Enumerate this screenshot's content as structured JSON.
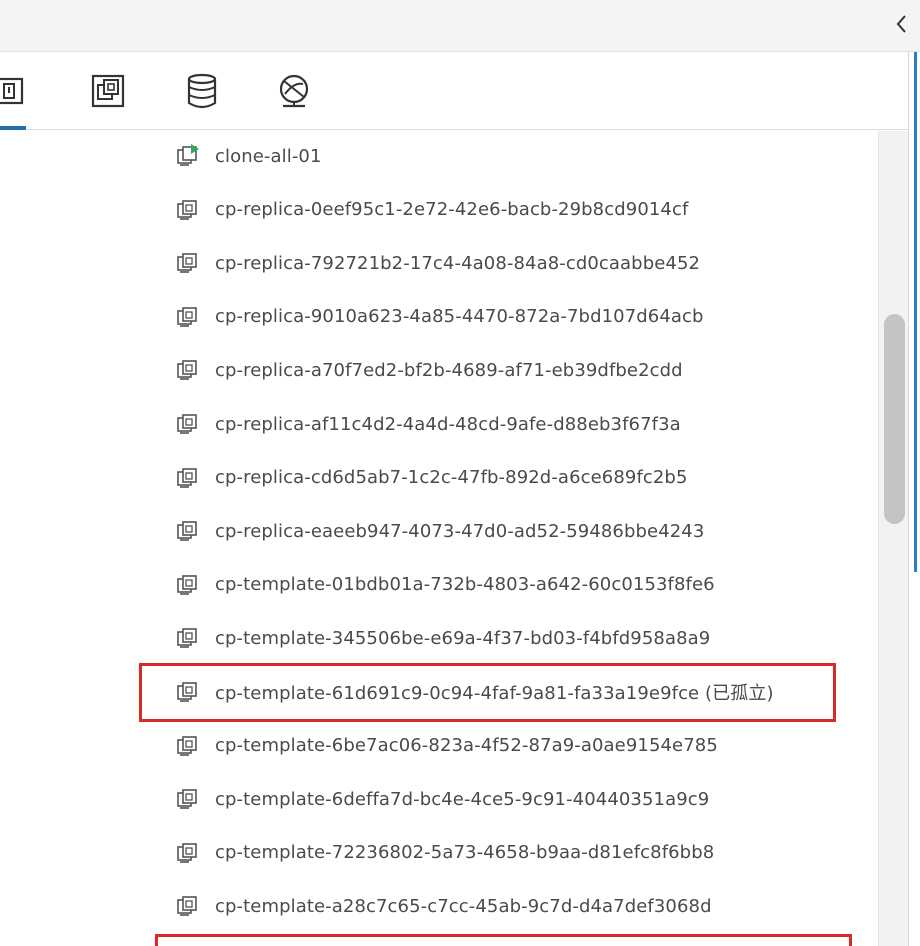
{
  "tabs": [
    {
      "name": "hosts-and-clusters",
      "icon": "hosts-clusters-icon",
      "active": true
    },
    {
      "name": "vms-and-templates",
      "icon": "vms-templates-icon",
      "active": false
    },
    {
      "name": "storage",
      "icon": "storage-icon",
      "active": false
    },
    {
      "name": "networking",
      "icon": "networking-icon",
      "active": false
    }
  ],
  "collapse_icon": "chevron-left-icon",
  "items": [
    {
      "label": "clone-all-01",
      "icon": "vm-powered-on-icon"
    },
    {
      "label": "cp-replica-0eef95c1-2e72-42e6-bacb-29b8cd9014cf",
      "icon": "vm-icon"
    },
    {
      "label": "cp-replica-792721b2-17c4-4a08-84a8-cd0caabbe452",
      "icon": "vm-icon"
    },
    {
      "label": "cp-replica-9010a623-4a85-4470-872a-7bd107d64acb",
      "icon": "vm-icon"
    },
    {
      "label": "cp-replica-a70f7ed2-bf2b-4689-af71-eb39dfbe2cdd",
      "icon": "vm-icon"
    },
    {
      "label": "cp-replica-af11c4d2-4a4d-48cd-9afe-d88eb3f67f3a",
      "icon": "vm-icon"
    },
    {
      "label": "cp-replica-cd6d5ab7-1c2c-47fb-892d-a6ce689fc2b5",
      "icon": "vm-icon"
    },
    {
      "label": "cp-replica-eaeeb947-4073-47d0-ad52-59486bbe4243",
      "icon": "vm-icon"
    },
    {
      "label": "cp-template-01bdb01a-732b-4803-a642-60c0153f8fe6",
      "icon": "vm-icon"
    },
    {
      "label": "cp-template-345506be-e69a-4f37-bd03-f4bfd958a8a9",
      "icon": "vm-icon"
    },
    {
      "label": "cp-template-61d691c9-0c94-4faf-9a81-fa33a19e9fce (已孤立)",
      "icon": "vm-icon",
      "highlighted": true
    },
    {
      "label": "cp-template-6be7ac06-823a-4f52-87a9-a0ae9154e785",
      "icon": "vm-icon"
    },
    {
      "label": "cp-template-6deffa7d-bc4e-4ce5-9c91-40440351a9c9",
      "icon": "vm-icon"
    },
    {
      "label": "cp-template-72236802-5a73-4658-b9aa-d81efc8f6bb8",
      "icon": "vm-icon"
    },
    {
      "label": "cp-template-a28c7c65-c7cc-45ab-9c7d-d4a7def3068d",
      "icon": "vm-icon"
    }
  ],
  "colors": {
    "accent": "#1f6fae",
    "highlight": "#d62b2b",
    "power_on": "#3aa655"
  }
}
